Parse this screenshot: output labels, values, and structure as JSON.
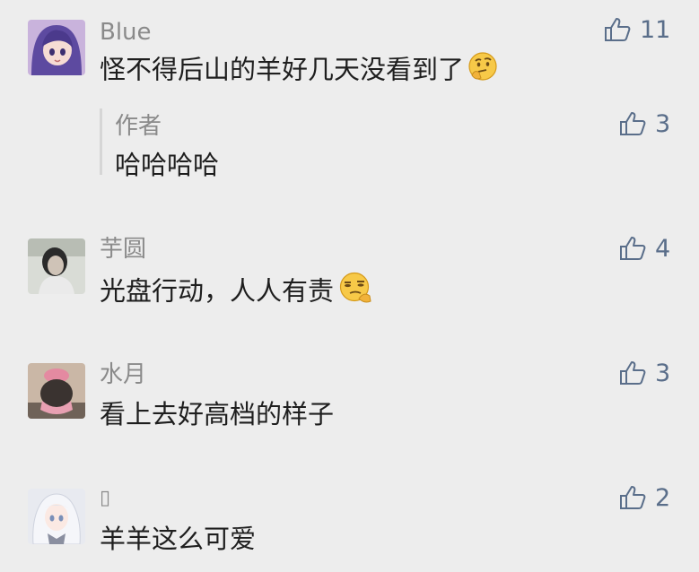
{
  "comments": [
    {
      "name": "Blue",
      "text": "怪不得后山的羊好几天没看到了",
      "likes": "11",
      "reply": {
        "name": "作者",
        "text": "哈哈哈哈",
        "likes": "3"
      }
    },
    {
      "name": "芋圆",
      "text": "光盘行动，人人有责",
      "likes": "4"
    },
    {
      "name": "水月",
      "text": "看上去好高档的样子",
      "likes": "3"
    },
    {
      "name": "▯",
      "text": "羊羊这么可爱",
      "likes": "2"
    }
  ]
}
